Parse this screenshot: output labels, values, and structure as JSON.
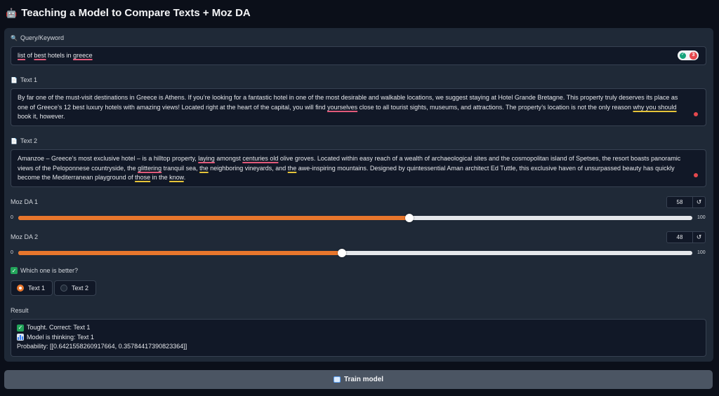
{
  "app": {
    "title": "Teaching a Model to Compare Texts + Moz DA",
    "title_icon": "robot-icon"
  },
  "query": {
    "label": "Query/Keyword",
    "icon": "magnifier-icon",
    "value_parts": [
      "list",
      " of ",
      "best",
      " hotels in ",
      "greece"
    ],
    "grammar_count": "3"
  },
  "text1": {
    "label": "Text 1",
    "icon": "document-icon",
    "parts": [
      "By far one of the must-visit destinations in Greece is Athens. If you’re looking for a fantastic hotel in one of the most desirable and walkable locations, we suggest staying at Hotel Grande Bretagne. This property truly deserves its place as one of Greece’s 12 best luxury hotels with amazing views! Located right at the heart of the capital, you will find ",
      "yourselves",
      " close to all tourist sights, museums, and attractions. The property’s location is not the only reason ",
      "why you should",
      " book it, however."
    ]
  },
  "text2": {
    "label": "Text 2",
    "icon": "document-icon",
    "parts": [
      "Amanzoe – Greece’s most exclusive hotel – is a hilltop property, ",
      "laying",
      " amongst ",
      "centuries old",
      " olive groves. Located within easy reach of a wealth of archaeological sites and the cosmopolitan island of Spetses, the resort boasts panoramic views of the Peloponnese countryside, the ",
      "glittering",
      " tranquil sea, ",
      "the",
      " neighboring vineyards, and ",
      "the",
      " awe-inspiring mountains. Designed by quintessential Aman architect Ed Tuttle, this exclusive haven of unsurpassed beauty has quickly become the Mediterranean playground of ",
      "those",
      " in the ",
      "know",
      "."
    ]
  },
  "slider1": {
    "label": "Moz DA 1",
    "value": "58",
    "min": "0",
    "max": "100",
    "fraction": 0.58
  },
  "slider2": {
    "label": "Moz DA 2",
    "value": "48",
    "min": "0",
    "max": "100",
    "fraction": 0.48
  },
  "choice": {
    "label": "Which one is better?",
    "options": [
      "Text 1",
      "Text 2"
    ],
    "selected": "Text 1"
  },
  "result": {
    "label": "Result",
    "lines": [
      "Tought. Correct: Text 1",
      "Model is thinking: Text 1",
      "Probability: [[0.6421558260917664, 0.35784417390823364]]"
    ]
  },
  "train_button": {
    "label": "Train model",
    "icon": "train-icon"
  },
  "colors": {
    "accent": "#e8762c",
    "background": "#0b0f19",
    "panel": "#1f2937",
    "button": "#4b5563"
  }
}
